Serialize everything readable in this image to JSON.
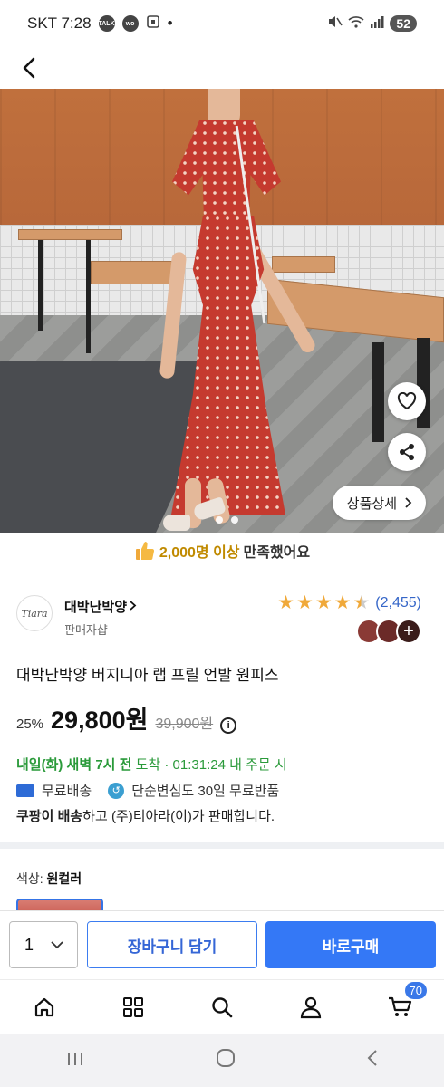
{
  "status_bar": {
    "carrier_time": "SKT 7:28",
    "icons": [
      "talk-icon",
      "wo-icon",
      "screenshot-icon"
    ],
    "dot": "•",
    "battery": "52"
  },
  "hero": {
    "detail_button_label": "상품상세",
    "slide_count": 2
  },
  "satisfaction": {
    "count": "2,000명 이상",
    "text": " 만족했어요"
  },
  "seller": {
    "logo_text": "Tiara",
    "name": "대박난박양",
    "sub": "판매자샵",
    "rating": 4.5,
    "review_count": "(2,455)",
    "swatch_colors": [
      "#8a3a35",
      "#6b2a28"
    ],
    "swatch_more": "+"
  },
  "product": {
    "title": "대박난박양 버지니아 랩 프릴 언발 원피스",
    "discount": "25%",
    "price": "29,800원",
    "original_price": "39,900원"
  },
  "delivery": {
    "bold": "내일(화) 새벽 7시 전",
    "rest": " 도착 · 01:31:24 내 주문 시",
    "free_shipping": "무료배송",
    "return_policy": "단순변심도 30일 무료반품",
    "coupang_bold": "쿠팡이 배송",
    "coupang_rest": "하고 (주)티아라(이)가 판매합니다."
  },
  "options": {
    "label": "색상: ",
    "value": "원컬러"
  },
  "action_bar": {
    "quantity": "1",
    "cart_label": "장바구니 담기",
    "buy_label": "바로구매"
  },
  "nav": {
    "cart_badge": "70"
  },
  "colors": {
    "primary": "#3478f6",
    "delivery_green": "#2a9a3a",
    "star": "#f0a93a"
  }
}
